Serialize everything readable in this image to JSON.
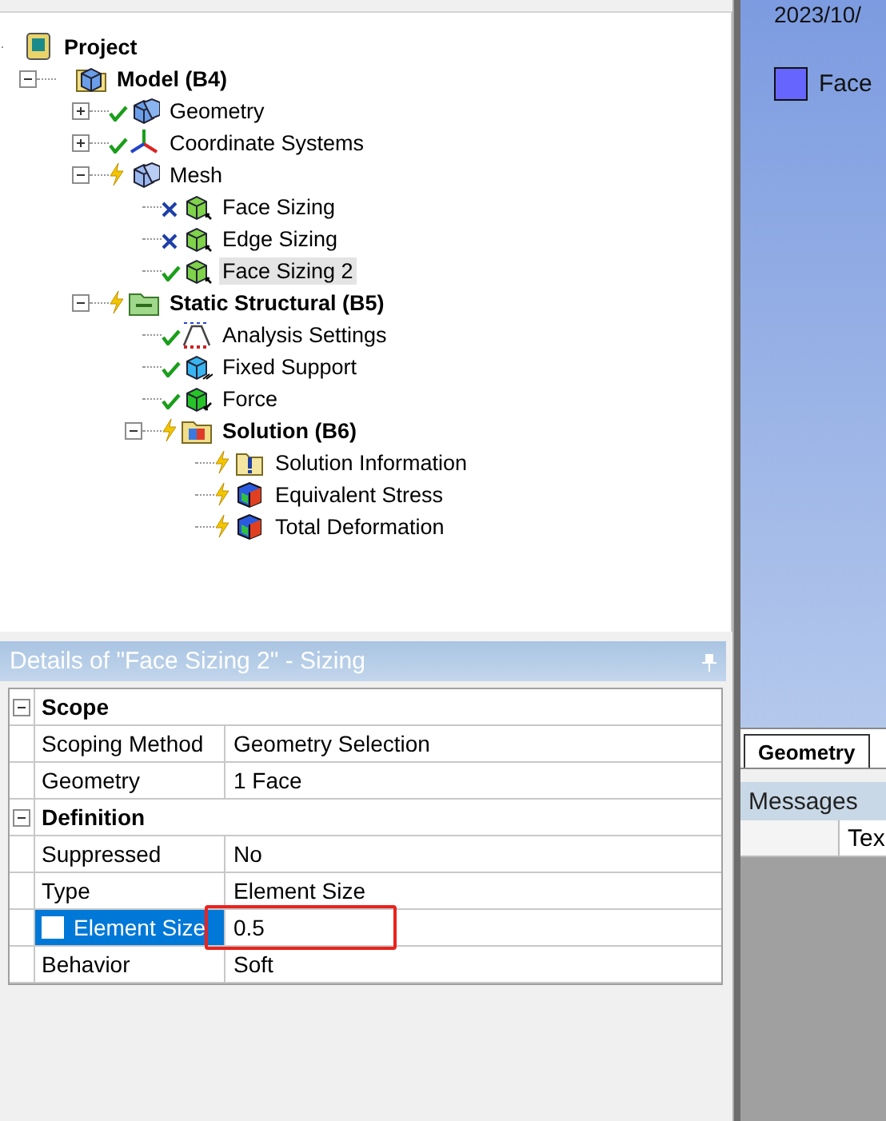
{
  "tree": {
    "label": "Project",
    "bold": true,
    "kind": "project",
    "selected": false,
    "children": [
      {
        "label": "Model (B4)",
        "bold": true,
        "kind": "model",
        "expanded": true,
        "selected": false,
        "children": [
          {
            "label": "Geometry",
            "bold": false,
            "kind": "geometry",
            "status": {
              "kind": "done"
            },
            "expanded": false,
            "selected": false
          },
          {
            "label": "Coordinate Systems",
            "bold": false,
            "kind": "axes",
            "status": {
              "kind": "done"
            },
            "expanded": false,
            "selected": false
          },
          {
            "label": "Mesh",
            "bold": false,
            "kind": "mesh",
            "status": {
              "kind": "pending"
            },
            "expanded": true,
            "selected": false,
            "children": [
              {
                "label": "Face Sizing",
                "bold": false,
                "kind": "sizing",
                "status": {
                  "kind": "undefined"
                },
                "selected": false
              },
              {
                "label": "Edge Sizing",
                "bold": false,
                "kind": "sizing",
                "status": {
                  "kind": "undefined"
                },
                "selected": false
              },
              {
                "label": "Face Sizing 2",
                "bold": false,
                "kind": "sizing",
                "status": {
                  "kind": "done"
                },
                "selected": true
              }
            ]
          },
          {
            "label": "Static Structural (B5)",
            "bold": true,
            "kind": "analysis",
            "status": {
              "kind": "pending"
            },
            "expanded": true,
            "selected": false,
            "children": [
              {
                "label": "Analysis Settings",
                "bold": false,
                "kind": "settings",
                "status": {
                  "kind": "done"
                },
                "selected": false
              },
              {
                "label": "Fixed Support",
                "bold": false,
                "kind": "support",
                "status": {
                  "kind": "done"
                },
                "selected": false
              },
              {
                "label": "Force",
                "bold": false,
                "kind": "force",
                "status": {
                  "kind": "done"
                },
                "selected": false
              },
              {
                "label": "Solution (B6)",
                "bold": true,
                "kind": "solution",
                "status": {
                  "kind": "pending"
                },
                "expanded": true,
                "selected": false,
                "children": [
                  {
                    "label": "Solution Information",
                    "bold": false,
                    "kind": "info",
                    "status": {
                      "kind": "pending"
                    },
                    "selected": false
                  },
                  {
                    "label": "Equivalent Stress",
                    "bold": false,
                    "kind": "result",
                    "status": {
                      "kind": "pending"
                    },
                    "selected": false
                  },
                  {
                    "label": "Total Deformation",
                    "bold": false,
                    "kind": "result",
                    "status": {
                      "kind": "pending"
                    },
                    "selected": false
                  }
                ]
              }
            ]
          }
        ]
      }
    ]
  },
  "details": {
    "title": "Details of \"Face Sizing 2\" - Sizing",
    "sections": [
      {
        "title": "Scope",
        "expanded": true,
        "rows": [
          {
            "name": "Scoping Method",
            "value": "Geometry Selection",
            "kind": "plain",
            "selected": false
          },
          {
            "name": "Geometry",
            "value": "1 Face",
            "kind": "plain",
            "selected": false
          }
        ]
      },
      {
        "title": "Definition",
        "expanded": true,
        "rows": [
          {
            "name": "Suppressed",
            "value": "No",
            "kind": "plain",
            "selected": false
          },
          {
            "name": "Type",
            "value": "Element Size",
            "kind": "plain",
            "selected": false
          },
          {
            "name": "Element Size",
            "value": "0.5",
            "kind": "parameter",
            "checked": false,
            "selected": true
          },
          {
            "name": "Behavior",
            "value": "Soft",
            "kind": "plain",
            "selected": false
          }
        ]
      }
    ],
    "annotation": {
      "kind": "rectangle",
      "color": "#e8231e"
    }
  },
  "viewport": {
    "date": "2023/10/",
    "legend": [
      {
        "label": "Face",
        "color": "#6666ff"
      }
    ],
    "tabs": [
      {
        "label": "Geometry",
        "selected": true
      }
    ]
  },
  "messages": {
    "title": "Messages",
    "columns": [
      "Tex"
    ]
  }
}
